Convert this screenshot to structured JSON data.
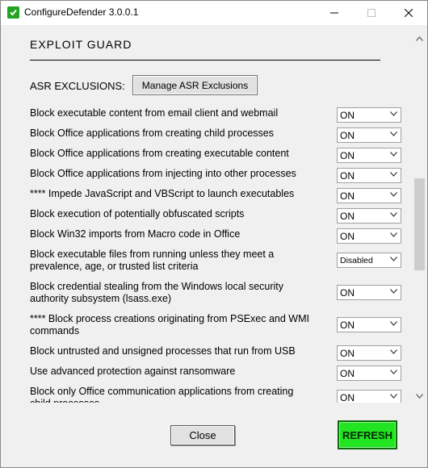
{
  "window": {
    "title": "ConfigureDefender 3.0.0.1"
  },
  "section": {
    "title": "EXPLOIT  GUARD"
  },
  "asr": {
    "label": "ASR  EXCLUSIONS:",
    "button_label": "Manage ASR Exclusions"
  },
  "rules": [
    {
      "label": "Block executable content from email client and webmail",
      "value": "ON"
    },
    {
      "label": "Block Office applications from creating child processes",
      "value": "ON"
    },
    {
      "label": "Block Office applications from creating executable content",
      "value": "ON"
    },
    {
      "label": "Block Office applications from injecting into other processes",
      "value": "ON"
    },
    {
      "label": "**** Impede JavaScript and VBScript to launch executables",
      "value": "ON"
    },
    {
      "label": "Block execution of potentially obfuscated scripts",
      "value": "ON"
    },
    {
      "label": "Block Win32 imports from Macro code in Office",
      "value": "ON"
    },
    {
      "label": "Block executable files from running unless they meet a prevalence, age, or trusted list criteria",
      "value": "Disabled"
    },
    {
      "label": "Block credential stealing from the Windows local security authority subsystem (lsass.exe)",
      "value": "ON"
    },
    {
      "label": "**** Block process creations originating from PSExec and WMI commands",
      "value": "ON"
    },
    {
      "label": "Block untrusted and unsigned processes that run from USB",
      "value": "ON"
    },
    {
      "label": "Use advanced protection against ransomware",
      "value": "ON"
    },
    {
      "label": "Block only Office communication applications from creating child processes",
      "value": "ON"
    }
  ],
  "footer": {
    "close_label": "Close",
    "refresh_label": "REFRESH"
  },
  "colors": {
    "refresh_bg": "#22e522",
    "app_icon": "#22a322"
  },
  "icons": {
    "app": "shield-check-icon",
    "minimize": "minimize-icon",
    "maximize": "maximize-icon",
    "close": "close-icon",
    "dropdown": "chevron-down-icon",
    "scroll_up": "scroll-up-arrow-icon",
    "scroll_down": "scroll-down-arrow-icon"
  }
}
